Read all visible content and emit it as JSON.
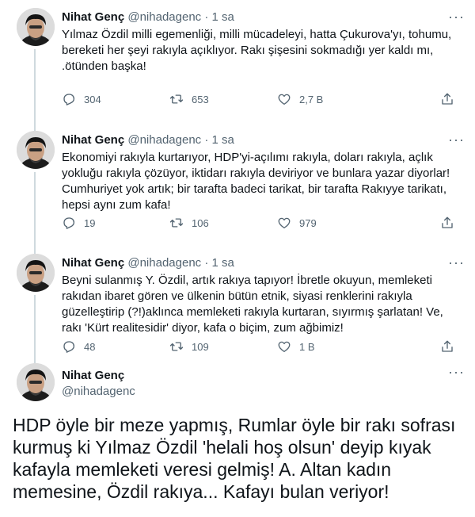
{
  "thread": [
    {
      "name": "Nihat Genç",
      "handle": "@nihadagenc",
      "dot": "·",
      "time": "1 sa",
      "text": "Yılmaz Özdil milli egemenliği, milli mücadeleyi, hatta Çukurova'yı, tohumu,\nbereketi her şeyi rakıyla açıklıyor. Rakı şişesini sokmadığı yer kaldı mı,\n.ötünden başka!",
      "replies": "304",
      "retweets": "653",
      "likes": "2,7 B"
    },
    {
      "name": "Nihat Genç",
      "handle": "@nihadagenc",
      "dot": "·",
      "time": "1 sa",
      "text": "Ekonomiyi rakıyla kurtarıyor, HDP'yi-açılımı rakıyla, doları rakıyla, açlık\nyokluğu rakıyla çözüyor, iktidarı rakıyla deviriyor ve bunlara yazar diyorlar!\nCumhuriyet yok artık; bir tarafta badeci tarikat, bir tarafta Rakıyye tarikatı,\nhepsi aynı zum kafa!",
      "replies": "19",
      "retweets": "106",
      "likes": "979"
    },
    {
      "name": "Nihat Genç",
      "handle": "@nihadagenc",
      "dot": "·",
      "time": "1 sa",
      "text": "Beyni sulanmış Y. Özdil, artık rakıya tapıyor! İbretle okuyun, memleketi\nrakıdan ibaret gören ve ülkenin bütün etnik, siyasi renklerini rakıyla\ngüzelleştirip (?!)aklınca memleketi rakıyla kurtaran, sıyırmış şarlatan! Ve,\nrakı 'Kürt realitesidir' diyor, kafa o biçim, zum ağbimiz!",
      "replies": "48",
      "retweets": "109",
      "likes": "1 B"
    }
  ],
  "main": {
    "name": "Nihat Genç",
    "handle": "@nihadagenc",
    "text": "HDP öyle bir meze yapmış, Rumlar öyle bir rakı sofrası kurmuş ki Yılmaz Özdil 'helali hoş olsun' deyip kıyak kafayla memleketi veresi gelmiş! A. Altan kadın memesine, Özdil rakıya... Kafayı bulan veriyor!"
  },
  "icons": {
    "more": "more-icon",
    "reply": "reply-icon",
    "retweet": "retweet-icon",
    "like": "like-icon",
    "share": "share-icon"
  },
  "colors": {
    "text": "#0f1419",
    "secondary": "#536471",
    "thread_line": "#cfd9de"
  }
}
